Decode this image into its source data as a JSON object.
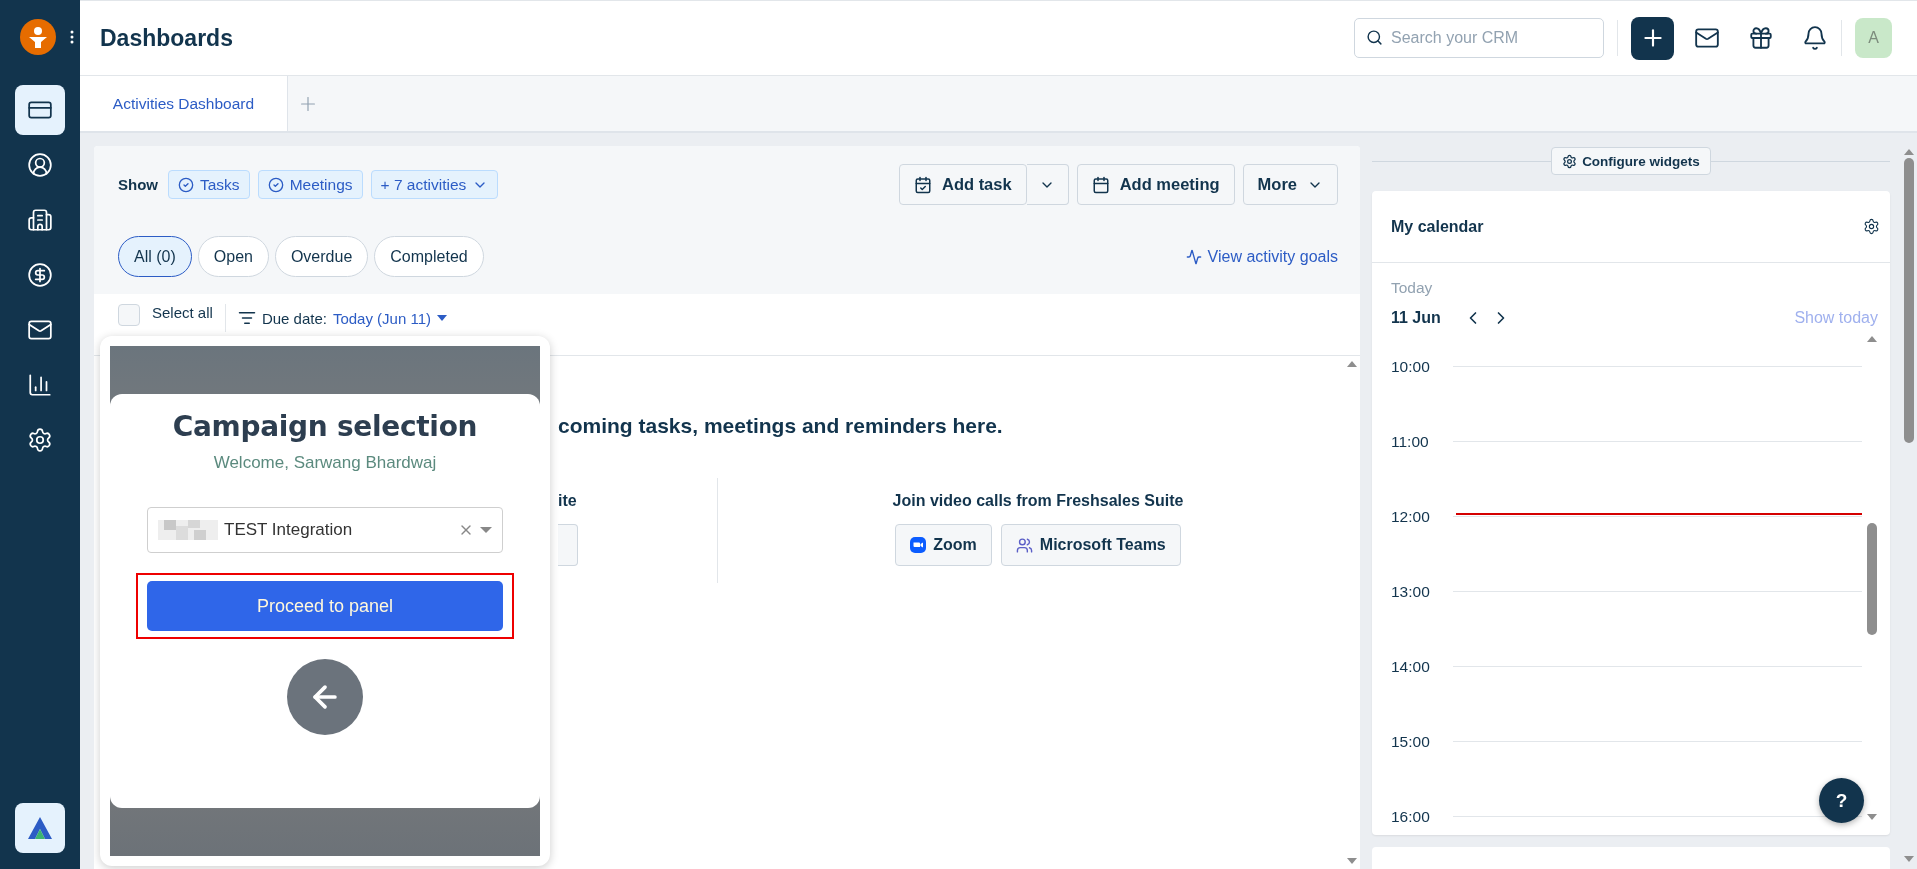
{
  "sidebar": {
    "items": [
      {
        "selected": true
      },
      {
        "selected": false
      },
      {
        "selected": false
      },
      {
        "selected": false
      },
      {
        "selected": false
      },
      {
        "selected": false
      },
      {
        "selected": false
      }
    ]
  },
  "header": {
    "title": "Dashboards",
    "search": {
      "placeholder": "Search your CRM"
    },
    "avatar": "A"
  },
  "tabs": [
    {
      "label": "Activities Dashboard",
      "selected": true
    }
  ],
  "activities": {
    "show_label": "Show",
    "show_chips": [
      {
        "label": "Tasks",
        "kind": "check"
      },
      {
        "label": "Meetings",
        "kind": "check"
      },
      {
        "label": "+ 7 activities",
        "kind": "dropdown"
      }
    ],
    "actions": [
      {
        "label": "Add task",
        "kind": "split"
      },
      {
        "label": "Add meeting",
        "kind": "calendar"
      },
      {
        "label": "More",
        "kind": "dropdown"
      }
    ],
    "filters": [
      {
        "label": "All (0)",
        "selected": true
      },
      {
        "label": "Open",
        "selected": false
      },
      {
        "label": "Overdue",
        "selected": false
      },
      {
        "label": "Completed",
        "selected": false
      }
    ],
    "goals_link": "View activity goals",
    "select_all": {
      "label": "Select all",
      "checked": false
    },
    "due_date": {
      "label": "Due date:",
      "value": "Today (Jun 11)"
    },
    "empty_message": "coming tasks, meetings and reminders here.",
    "left_column": {
      "title": "ite"
    },
    "right_column": {
      "title": "Join video calls from Freshsales Suite",
      "buttons": [
        {
          "label": "Zoom",
          "kind": "zoom"
        },
        {
          "label": "Microsoft Teams",
          "kind": "teams"
        }
      ]
    }
  },
  "popup": {
    "title": "Campaign selection",
    "subtitle": "Welcome, Sarwang Bhardwaj",
    "select_value": "TEST Integration",
    "button": "Proceed to panel",
    "button_highlighted": true
  },
  "widgets": {
    "configure": "Configure widgets",
    "calendar": {
      "title": "My calendar",
      "today_label": "Today",
      "date": "11 Jun",
      "show_today": "Show today",
      "hours": [
        {
          "label": "10:00",
          "current": false
        },
        {
          "label": "11:00",
          "current": false
        },
        {
          "label": "12:00",
          "current": true
        },
        {
          "label": "13:00",
          "current": false
        },
        {
          "label": "14:00",
          "current": false
        },
        {
          "label": "15:00",
          "current": false
        },
        {
          "label": "16:00",
          "current": false
        }
      ]
    }
  },
  "help": "?"
}
